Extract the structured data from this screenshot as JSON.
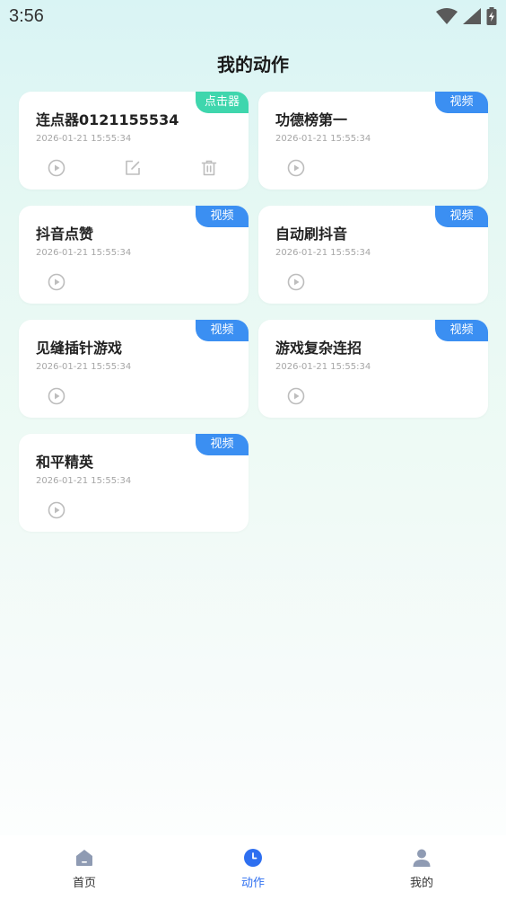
{
  "status_bar": {
    "time": "3:56",
    "icons": [
      "wifi-icon",
      "cell-signal-icon",
      "battery-charging-icon"
    ]
  },
  "page_title": "我的动作",
  "colors": {
    "clicker_badge": "#3fd6ad",
    "video_badge": "#3b8ff2",
    "tab_active": "#2e6ff0",
    "tab_inactive": "#8f9bb3",
    "action_icon": "#bdbdbd"
  },
  "cards": [
    {
      "title": "连点器0121155534",
      "time": "2026-01-21 15:55:34",
      "badge": "点击器",
      "actions": [
        "play-icon",
        "edit-icon",
        "delete-icon"
      ]
    },
    {
      "title": "功德榜第一",
      "time": "2026-01-21 15:55:34",
      "badge": "视频",
      "actions": [
        "play-icon"
      ]
    },
    {
      "title": "抖音点赞",
      "time": "2026-01-21 15:55:34",
      "badge": "视频",
      "actions": [
        "play-icon"
      ]
    },
    {
      "title": "自动刷抖音",
      "time": "2026-01-21 15:55:34",
      "badge": "视频",
      "actions": [
        "play-icon"
      ]
    },
    {
      "title": "见缝插针游戏",
      "time": "2026-01-21 15:55:34",
      "badge": "视频",
      "actions": [
        "play-icon"
      ]
    },
    {
      "title": "游戏复杂连招",
      "time": "2026-01-21 15:55:34",
      "badge": "视频",
      "actions": [
        "play-icon"
      ]
    },
    {
      "title": "和平精英",
      "time": "2026-01-21 15:55:34",
      "badge": "视频",
      "actions": [
        "play-icon"
      ]
    }
  ],
  "tabbar": {
    "items": [
      {
        "label": "首页",
        "icon": "home-icon",
        "active": false
      },
      {
        "label": "动作",
        "icon": "clock-icon",
        "active": true
      },
      {
        "label": "我的",
        "icon": "user-icon",
        "active": false
      }
    ]
  }
}
